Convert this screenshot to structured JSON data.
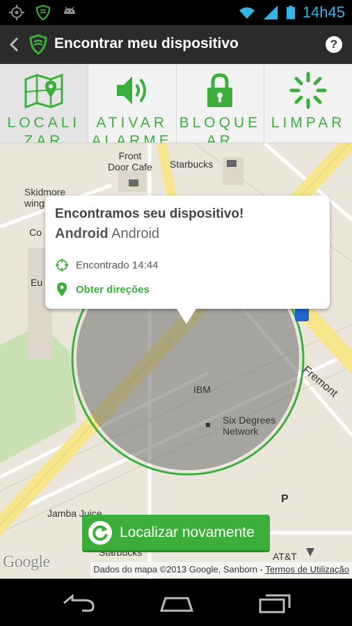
{
  "status_bar": {
    "time": "14h45",
    "icons": [
      "gps-icon",
      "shield-icon",
      "android-icon",
      "wifi-icon",
      "signal-icon",
      "battery-icon"
    ]
  },
  "action_bar": {
    "title": "Encontrar meu dispositivo",
    "help": "?"
  },
  "tabs": [
    {
      "label": "LOCALIZAR",
      "icon": "map-pin-icon",
      "active": true
    },
    {
      "label": "ATIVAR ALARME",
      "icon": "speaker-icon",
      "active": false
    },
    {
      "label": "BLOQUEAR",
      "icon": "lock-icon",
      "active": false
    },
    {
      "label": "LIMPAR",
      "icon": "wipe-icon",
      "active": false
    }
  ],
  "map": {
    "labels": {
      "front_door_cafe": "Front\nDoor Cafe",
      "starbucks_top": "Starbucks",
      "skidmore": "Skidmore\nwings & M",
      "com": "Co",
      "eu": "Eu",
      "ibm": "IBM",
      "six_degrees": "Six Degrees\nNetwork",
      "fremont": "Fremont",
      "jamba_juice": "Jamba Juice",
      "starbucks_bottom": "Starbucks",
      "att": "AT&T",
      "parking": "P"
    },
    "google_logo": "Google",
    "attribution": "Dados do mapa ©2013 Google, Sanborn - ",
    "terms": "Termos de Utilização"
  },
  "bubble": {
    "title": "Encontramos seu dispositivo!",
    "device_name": "Android",
    "device_model": "Android",
    "found_text": "Encontrado 14:44",
    "directions_text": "Obter direções"
  },
  "relocate_button": {
    "label": "Localizar novamente"
  },
  "colors": {
    "accent_green": "#3cae3c",
    "holo_blue": "#33b5e5",
    "action_bar": "#2b2b2b"
  }
}
